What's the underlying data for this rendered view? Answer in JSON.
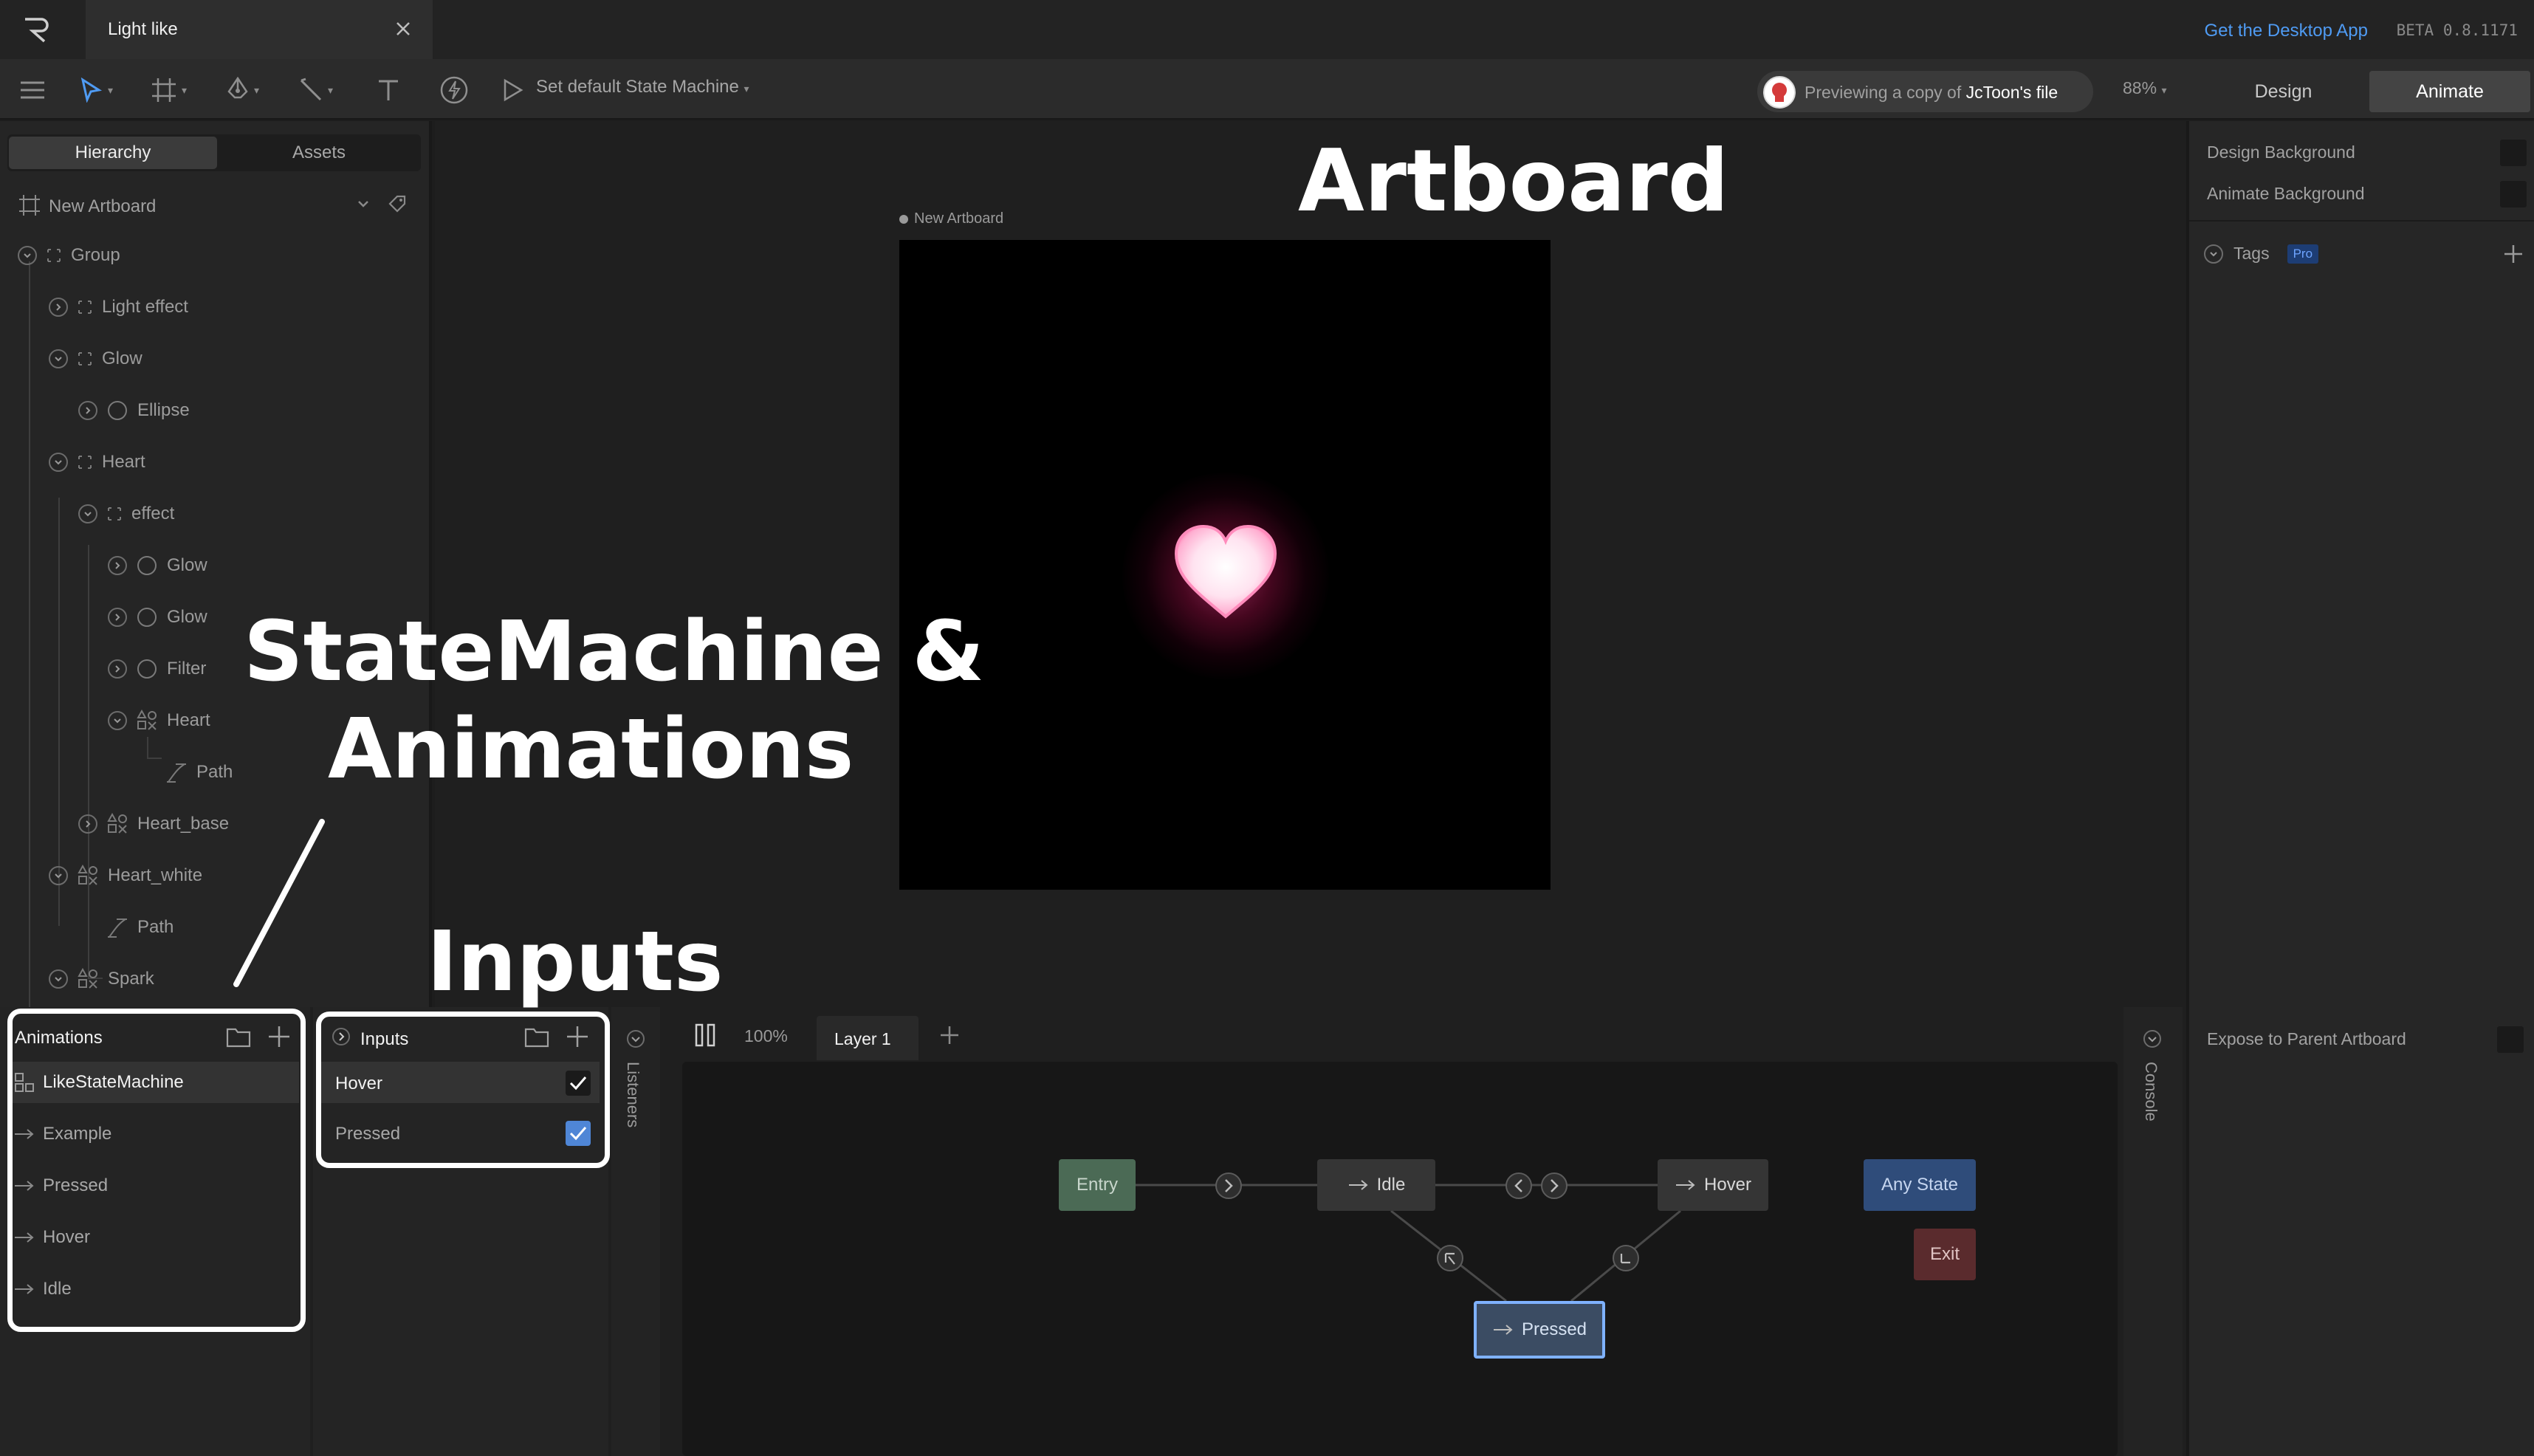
{
  "tabbar": {
    "file_tab_title": "Light like",
    "desktop_link": "Get the Desktop App",
    "beta_label": "BETA 0.8.1171"
  },
  "toolbar": {
    "state_machine_label": "Set default State Machine",
    "preview_prefix": "Previewing a copy of",
    "preview_owner": "JcToon's file",
    "zoom": "88%",
    "design_label": "Design",
    "animate_label": "Animate"
  },
  "hierarchy": {
    "tab_hierarchy": "Hierarchy",
    "tab_assets": "Assets",
    "artboard_name": "New Artboard",
    "items": [
      {
        "label": "Group",
        "icon": "group-icon"
      },
      {
        "label": "Light effect",
        "icon": "group-icon"
      },
      {
        "label": "Glow",
        "icon": "group-icon"
      },
      {
        "label": "Ellipse",
        "icon": "ellipse-icon"
      },
      {
        "label": "Heart",
        "icon": "group-icon"
      },
      {
        "label": "effect",
        "icon": "group-icon"
      },
      {
        "label": "Glow",
        "icon": "ellipse-icon"
      },
      {
        "label": "Glow",
        "icon": "ellipse-icon"
      },
      {
        "label": "Filter",
        "icon": "ellipse-icon"
      },
      {
        "label": "Heart",
        "icon": "shape-icon"
      },
      {
        "label": "Path",
        "icon": "path-icon"
      },
      {
        "label": "Heart_base",
        "icon": "shape-icon"
      },
      {
        "label": "Heart_white",
        "icon": "shape-icon"
      },
      {
        "label": "Path",
        "icon": "path-icon"
      },
      {
        "label": "Spark",
        "icon": "shape-icon"
      }
    ]
  },
  "stage": {
    "artboard_label": "New Artboard"
  },
  "inspector": {
    "design_background": "Design Background",
    "animate_background": "Animate Background",
    "tags_label": "Tags",
    "pro_badge": "Pro",
    "expose_label": "Expose to Parent Artboard"
  },
  "animations_panel": {
    "title": "Animations",
    "items": [
      "LikeStateMachine",
      "Example",
      "Pressed",
      "Hover",
      "Idle"
    ]
  },
  "inputs_panel": {
    "title": "Inputs",
    "items": [
      {
        "label": "Hover",
        "checked": true
      },
      {
        "label": "Pressed",
        "checked": true
      }
    ]
  },
  "side_tabs": {
    "listeners": "Listeners",
    "console": "Console"
  },
  "graph": {
    "zoom": "100%",
    "layer_tab": "Layer 1",
    "nodes": {
      "entry": "Entry",
      "idle": "Idle",
      "hover": "Hover",
      "any_state": "Any State",
      "exit": "Exit",
      "pressed": "Pressed"
    }
  },
  "annotations": {
    "artboard": "Artboard",
    "state_machine_line1": "StateMachine &",
    "state_machine_line2": "Animations",
    "inputs": "Inputs"
  },
  "colors": {
    "accent_blue": "#4f9bf3",
    "entry_node": "#4b6a55",
    "any_state_node": "#2f4c7a",
    "exit_node": "#5a2b2d",
    "pressed_border": "#7fb2ff"
  }
}
